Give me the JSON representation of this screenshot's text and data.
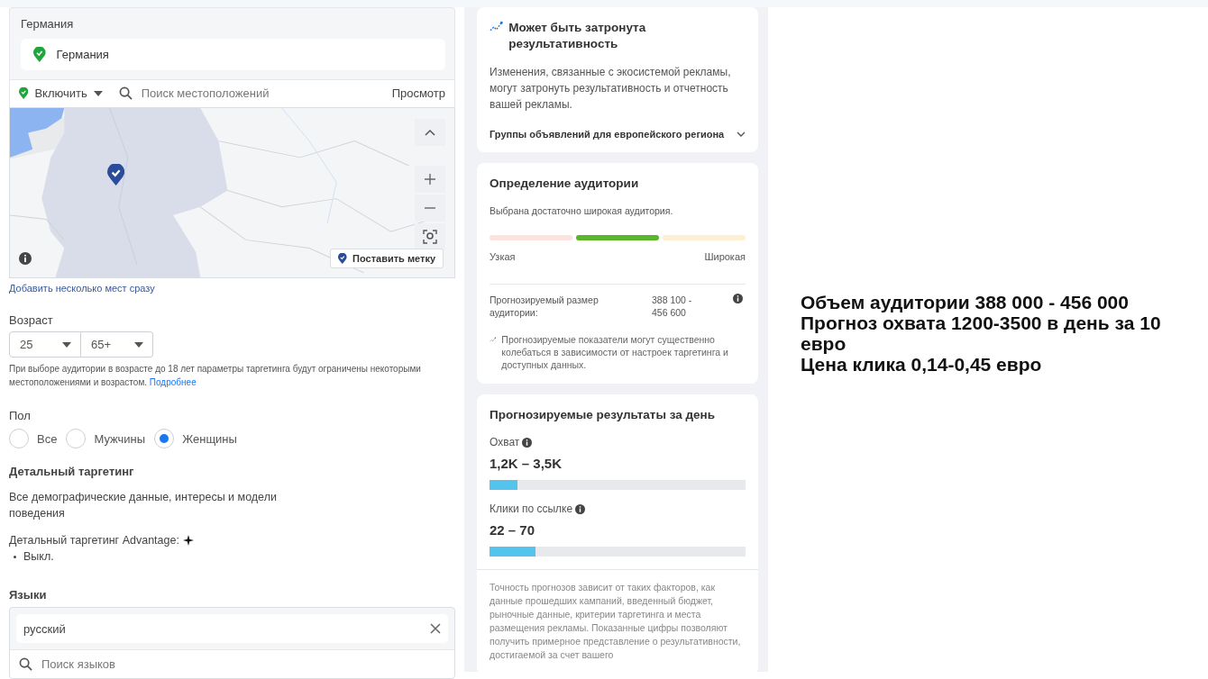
{
  "location": {
    "label": "Германия",
    "selected_location": "Германия",
    "include": "Включить",
    "search_placeholder": "Поиск местоположений",
    "view": "Просмотр",
    "pin_button": "Поставить метку",
    "add_many_link": "Добавить несколько мест сразу"
  },
  "age": {
    "label": "Возраст",
    "min": "25",
    "max": "65+",
    "note": "При выборе аудитории в возрасте до 18 лет параметры таргетинга будут ограничены некоторыми местоположениями и возрастом.",
    "note_link": "Подробнее"
  },
  "gender": {
    "label": "Пол",
    "options": [
      {
        "label": "Все",
        "selected": false
      },
      {
        "label": "Мужчины",
        "selected": false
      },
      {
        "label": "Женщины",
        "selected": true
      }
    ]
  },
  "detailed": {
    "title": "Детальный таргетинг",
    "description": "Все демографические данные, интересы и модели поведения",
    "advantage": "Детальный таргетинг Advantage:",
    "advantage_items": [
      "Выкл."
    ]
  },
  "languages": {
    "label": "Языки",
    "selected": "русский",
    "search_placeholder": "Поиск языков"
  },
  "performance_card": {
    "title": "Может быть затронута результативность",
    "text": "Изменения, связанные с экосистемой рекламы, могут затронуть результативность и отчетность вашей рекламы.",
    "expander": "Группы объявлений для европейского региона",
    "expanded": false
  },
  "audience_card": {
    "title": "Определение аудитории",
    "status": "Выбрана достаточно широкая аудитория.",
    "segments": [
      {
        "color": "#fde3e0"
      },
      {
        "color": "#5ab52a"
      },
      {
        "color": "#fdefd2"
      }
    ],
    "narrow": "Узкая",
    "wide": "Широкая",
    "size_label": "Прогнозируемый размер аудитории:",
    "size_value": "388 100 - 456 600",
    "disclaimer": "Прогнозируемые показатели могут существенно колебаться в зависимости от настроек таргетинга и доступных данных."
  },
  "results_card": {
    "title": "Прогнозируемые результаты за день",
    "metrics": [
      {
        "label": "Охват",
        "value": "1,2K – 3,5K",
        "level": 0.11
      },
      {
        "label": "Клики по ссылке",
        "value": "22 – 70",
        "level": 0.18
      }
    ],
    "footer": "Точность прогнозов зависит от таких факторов, как данные прошедших кампаний, введенный бюджет, рыночные данные, критерии таргетинга и места размещения рекламы. Показанные цифры позволяют получить примерное представление о результативности, достигаемой за счет вашего"
  },
  "annotation": [
    "Объем аудитории 388 000 - 456 000",
    "Прогноз охвата 1200-3500 в день за 10 евро",
    "Цена клика 0,14-0,45 евро"
  ]
}
